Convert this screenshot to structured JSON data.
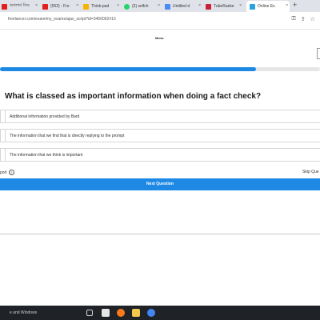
{
  "browser": {
    "tabs": [
      {
        "label": "অ্যালার্ম সিড",
        "icon": "youtube-icon",
        "color": "#e02020"
      },
      {
        "label": "(552) - Fre",
        "icon": "youtube-icon",
        "color": "#e02020"
      },
      {
        "label": "Think-pad",
        "icon": "page-icon",
        "color": "#f6b400"
      },
      {
        "label": "(2) selfch",
        "icon": "whatsapp-icon",
        "color": "#25d366"
      },
      {
        "label": "Untitled d",
        "icon": "meet-icon",
        "color": "#4c8bf5"
      },
      {
        "label": "TubeRanke",
        "icon": "tuberanker-icon",
        "color": "#cc1f3a"
      },
      {
        "label": "Online Ex",
        "icon": "freelancer-icon",
        "color": "#29a3e0"
      }
    ],
    "new_tab": "+",
    "url": "freelancer.com/exam/my_exams/ajax_script?id=3450092#13"
  },
  "page": {
    "brand": "Menu",
    "progress_percent": 80,
    "question": "What is classed as important information when doing a fact check?",
    "options": [
      "Additional information provided by Bard",
      "The information that we find that is directly replying to the prompt",
      "The information that we think is important"
    ],
    "report_label": "port",
    "skip_label": "Skip Que",
    "next_label": "Next Question"
  },
  "taskbar": {
    "search_text": "e and Windows"
  },
  "colors": {
    "accent": "#1e88e5",
    "taskbar": "#1f2328"
  }
}
